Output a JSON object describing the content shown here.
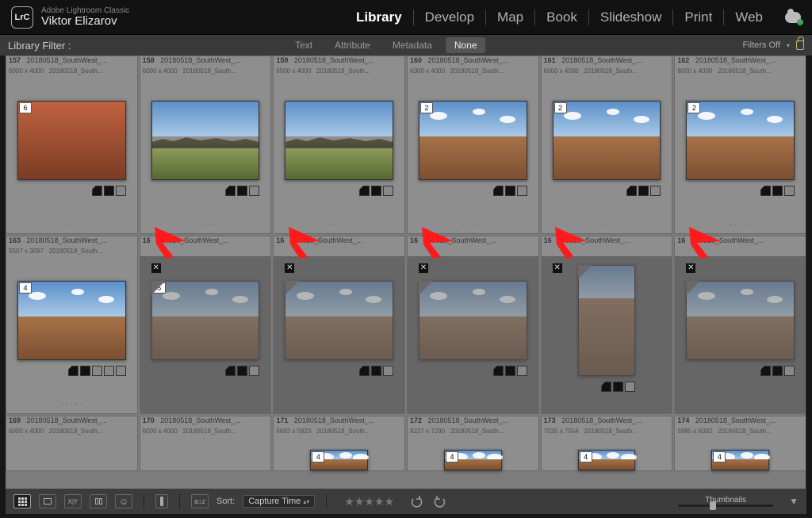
{
  "header": {
    "logo_text": "LrC",
    "app_name": "Adobe Lightroom Classic",
    "author": "Viktor Elizarov",
    "modules": [
      "Library",
      "Develop",
      "Map",
      "Book",
      "Slideshow",
      "Print",
      "Web"
    ],
    "active_module": "Library"
  },
  "filterbar": {
    "label": "Library Filter :",
    "items": [
      "Text",
      "Attribute",
      "Metadata",
      "None"
    ],
    "active": "None",
    "filters_off": "Filters Off"
  },
  "grid": {
    "rows": [
      {
        "cells": [
          {
            "idx": "157",
            "file": "20180518_SouthWest_...",
            "dim": "6000 x 4000",
            "sub": "20180518_South...",
            "stack": "6",
            "selected": false,
            "faded": false,
            "variant": "rock"
          },
          {
            "idx": "158",
            "file": "20180518_SouthWest_...",
            "dim": "6000 x 4000",
            "sub": "20180518_South...",
            "stack": "",
            "selected": false,
            "faded": false,
            "variant": "valley"
          },
          {
            "idx": "159",
            "file": "20180518_SouthWest_...",
            "dim": "6000 x 4000",
            "sub": "20180518_South...",
            "stack": "",
            "selected": false,
            "faded": false,
            "variant": "valley"
          },
          {
            "idx": "160",
            "file": "20180518_SouthWest_...",
            "dim": "6000 x 4000",
            "sub": "20180518_South...",
            "stack": "2",
            "selected": false,
            "faded": false,
            "variant": "sky"
          },
          {
            "idx": "161",
            "file": "20180518_SouthWest_...",
            "dim": "6000 x 4000",
            "sub": "20180518_South...",
            "stack": "2",
            "selected": false,
            "faded": false,
            "variant": "sky"
          },
          {
            "idx": "162",
            "file": "20180518_SouthWest_...",
            "dim": "6000 x 4000",
            "sub": "20180518_South...",
            "stack": "2",
            "selected": false,
            "faded": false,
            "variant": "sky"
          }
        ]
      },
      {
        "cells": [
          {
            "idx": "163",
            "file": "20180518_SouthWest_...",
            "dim": "5507 x 3097",
            "sub": "20180518_South...",
            "stack": "4",
            "selected": false,
            "faded": false,
            "variant": "road",
            "arrow": false,
            "dogear": false
          },
          {
            "idx": "16",
            "file": "180518_SouthWest_...",
            "dim": "",
            "sub": "",
            "stack": "5",
            "selected": true,
            "faded": true,
            "variant": "flat",
            "arrow": true,
            "dogear": true
          },
          {
            "idx": "16",
            "file": "180518_SouthWest_...",
            "dim": "",
            "sub": "",
            "stack": "",
            "selected": true,
            "faded": true,
            "variant": "flat",
            "arrow": true,
            "dogear": true
          },
          {
            "idx": "16",
            "file": "180518_SouthWest_...",
            "dim": "",
            "sub": "",
            "stack": "",
            "selected": true,
            "faded": true,
            "variant": "flat",
            "arrow": true,
            "dogear": true
          },
          {
            "idx": "16",
            "file": "180518_SouthWest_...",
            "dim": "",
            "sub": "",
            "stack": "",
            "selected": true,
            "faded": true,
            "variant": "tall",
            "arrow": true,
            "dogear": true
          },
          {
            "idx": "16",
            "file": "180518_SouthWest_...",
            "dim": "",
            "sub": "",
            "stack": "",
            "selected": true,
            "faded": true,
            "variant": "flat",
            "arrow": true,
            "dogear": true
          }
        ]
      },
      {
        "cells": [
          {
            "idx": "169",
            "file": "20180518_SouthWest_...",
            "dim": "6000 x 4000",
            "sub": "20180518_South...",
            "stack": "",
            "variant": "none"
          },
          {
            "idx": "170",
            "file": "20180518_SouthWest_...",
            "dim": "6000 x 4000",
            "sub": "20180518_South...",
            "stack": "",
            "variant": "none"
          },
          {
            "idx": "171",
            "file": "20180518_SouthWest_...",
            "dim": "5683 x 5823",
            "sub": "20180518_South...",
            "stack": "4",
            "variant": "tile"
          },
          {
            "idx": "172",
            "file": "20180518_SouthWest_...",
            "dim": "8237 x 7290",
            "sub": "20180518_South...",
            "stack": "4",
            "variant": "tile"
          },
          {
            "idx": "173",
            "file": "20180518_SouthWest_...",
            "dim": "7035 x 7554",
            "sub": "20180518_South...",
            "stack": "4",
            "variant": "tile"
          },
          {
            "idx": "174",
            "file": "20180518_SouthWest_...",
            "dim": "5985 x 6082",
            "sub": "20180518_South...",
            "stack": "4",
            "variant": "tile"
          }
        ]
      }
    ]
  },
  "bottom": {
    "sort_label": "Sort:",
    "sort_value": "Capture Time",
    "thumbs_label": "Thumbnails"
  }
}
